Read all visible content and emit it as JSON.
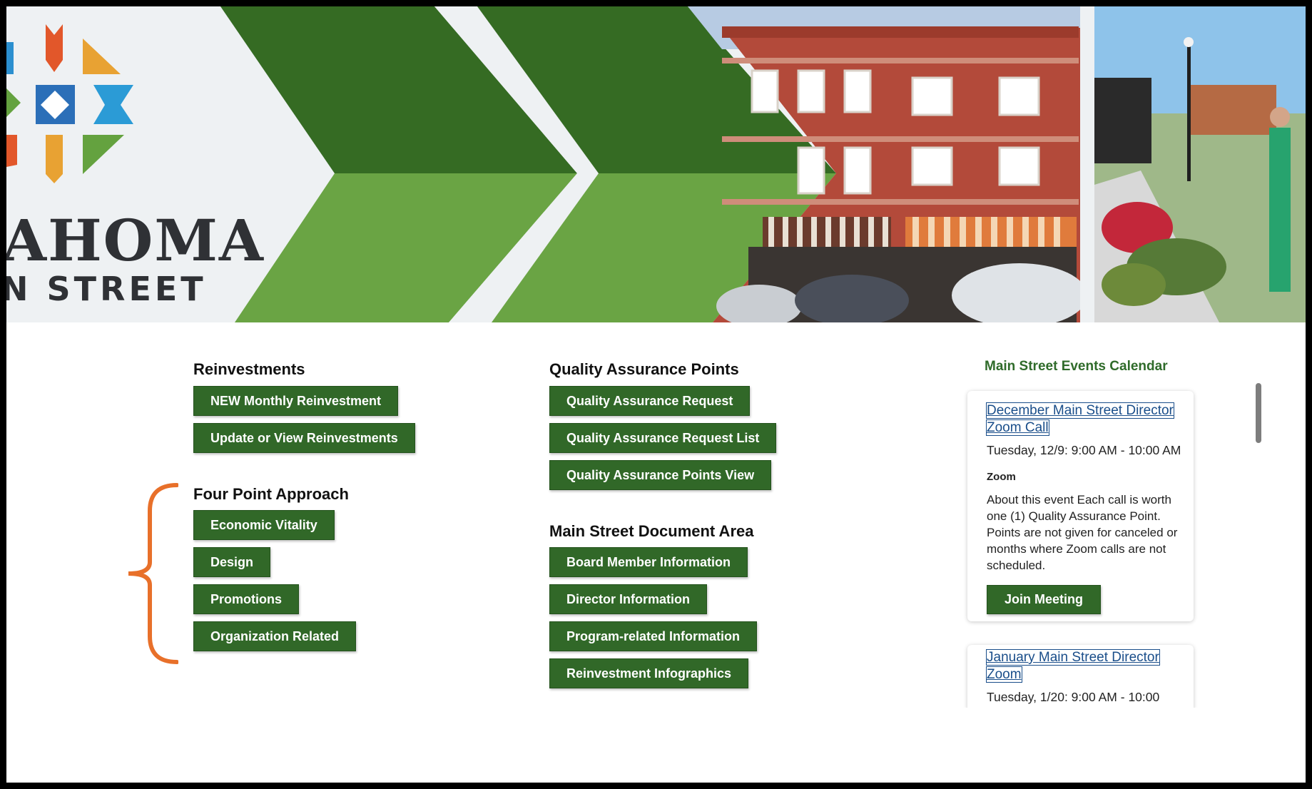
{
  "banner": {
    "logo_text": "AHOMA",
    "logo_subtext": "N STREET"
  },
  "reinvestments": {
    "title": "Reinvestments",
    "buttons": [
      "NEW Monthly Reinvestment",
      "Update or View Reinvestments"
    ]
  },
  "four_point": {
    "title": "Four Point Approach",
    "buttons": [
      "Economic Vitality",
      "Design",
      "Promotions",
      "Organization Related"
    ]
  },
  "quality_assurance": {
    "title": "Quality Assurance Points",
    "buttons": [
      "Quality Assurance Request",
      "Quality Assurance Request List",
      "Quality Assurance Points View"
    ]
  },
  "document_area": {
    "title": "Main Street Document Area",
    "buttons": [
      "Board Member Information",
      "Director Information",
      "Program-related Information",
      "Reinvestment Infographics"
    ]
  },
  "calendar": {
    "title": "Main Street Events Calendar",
    "events": [
      {
        "title": "December Main Street Director Zoom Call",
        "time": "Tuesday, 12/9: 9:00 AM - 10:00 AM",
        "location": "Zoom",
        "description": "About this event Each call is worth one (1) Quality Assurance Point. Points are not given for canceled or months where Zoom calls are not scheduled.",
        "button": "Join Meeting"
      },
      {
        "title": "January Main Street Director Zoom",
        "time": "Tuesday, 1/20: 9:00 AM - 10:00"
      }
    ]
  },
  "colors": {
    "button_green": "#316828",
    "dark_green": "#356b23",
    "light_green": "#6aa444",
    "brace_orange": "#e8702a",
    "link_blue": "#1a4e8a"
  }
}
